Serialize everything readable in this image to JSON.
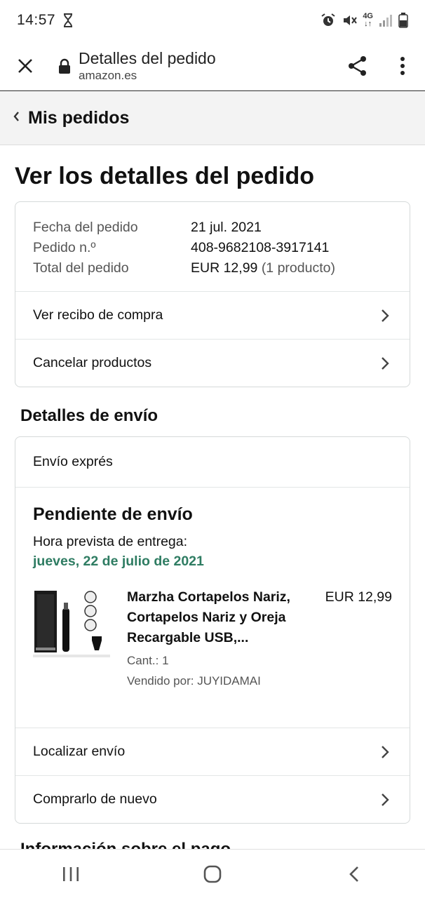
{
  "status_bar": {
    "time": "14:57",
    "network": "4G"
  },
  "browser": {
    "page_title": "Detalles del pedido",
    "domain": "amazon.es"
  },
  "breadcrumb": {
    "label": "Mis pedidos"
  },
  "heading": "Ver los detalles del pedido",
  "order_summary": {
    "rows": [
      {
        "label": "Fecha del pedido",
        "value": "21 jul. 2021"
      },
      {
        "label": "Pedido n.º",
        "value": "408-9682108-3917141"
      },
      {
        "label": "Total del pedido",
        "value": "EUR 12,99",
        "note": "(1 producto)"
      }
    ],
    "links": [
      "Ver recibo de compra",
      "Cancelar productos"
    ]
  },
  "shipping": {
    "heading": "Detalles de envío",
    "method": "Envío exprés",
    "status": "Pendiente de envío",
    "eta_label": "Hora prevista de entrega:",
    "eta_date": "jueves, 22 de julio de 2021",
    "item": {
      "name": "Marzha Cortapelos Nariz, Cortapelos Nariz y Oreja Recargable USB,...",
      "quantity": "Cant.: 1",
      "seller": "Vendido por: JUYIDAMAI",
      "price": "EUR 12,99"
    },
    "links": [
      "Localizar envío",
      "Comprarlo de nuevo"
    ]
  },
  "payment": {
    "heading": "Información sobre el pago"
  },
  "colors": {
    "eta_green": "#2e7c62",
    "breadcrumb_bg": "#f3f3f3",
    "card_border": "#d5d9d9"
  },
  "icons": [
    "hourglass-icon",
    "alarm-icon",
    "mute-icon",
    "signal-icon",
    "battery-icon",
    "close-icon",
    "lock-icon",
    "share-icon",
    "more-vert-icon",
    "chevron-left-icon",
    "chevron-right-icon",
    "recents-icon",
    "home-icon",
    "back-icon"
  ]
}
